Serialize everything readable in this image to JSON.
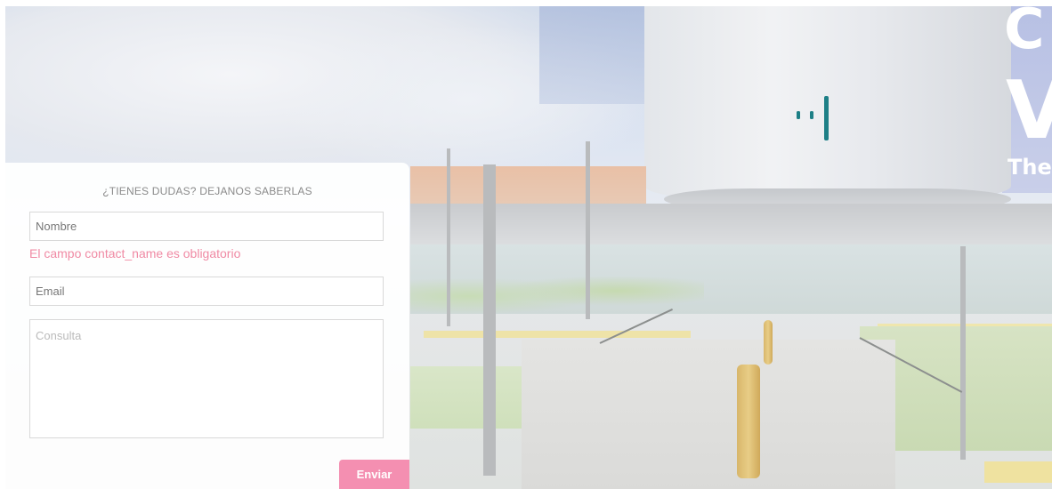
{
  "hero": {
    "title_partial_1": "C",
    "title_partial_2": "V",
    "subtitle_partial": "The",
    "logo_icon": "signal-bars-logo-icon",
    "logo_color": "#1d7f86"
  },
  "contact_form": {
    "heading": "¿TIENES DUDAS? DEJANOS SABERLAS",
    "name_value": "Nombre",
    "name_error": "El campo contact_name es obligatorio",
    "email_value": "Email",
    "query_placeholder": "Consulta",
    "submit_label": "Enviar"
  },
  "colors": {
    "accent": "#f48fb1",
    "error": "#f08aa4"
  }
}
